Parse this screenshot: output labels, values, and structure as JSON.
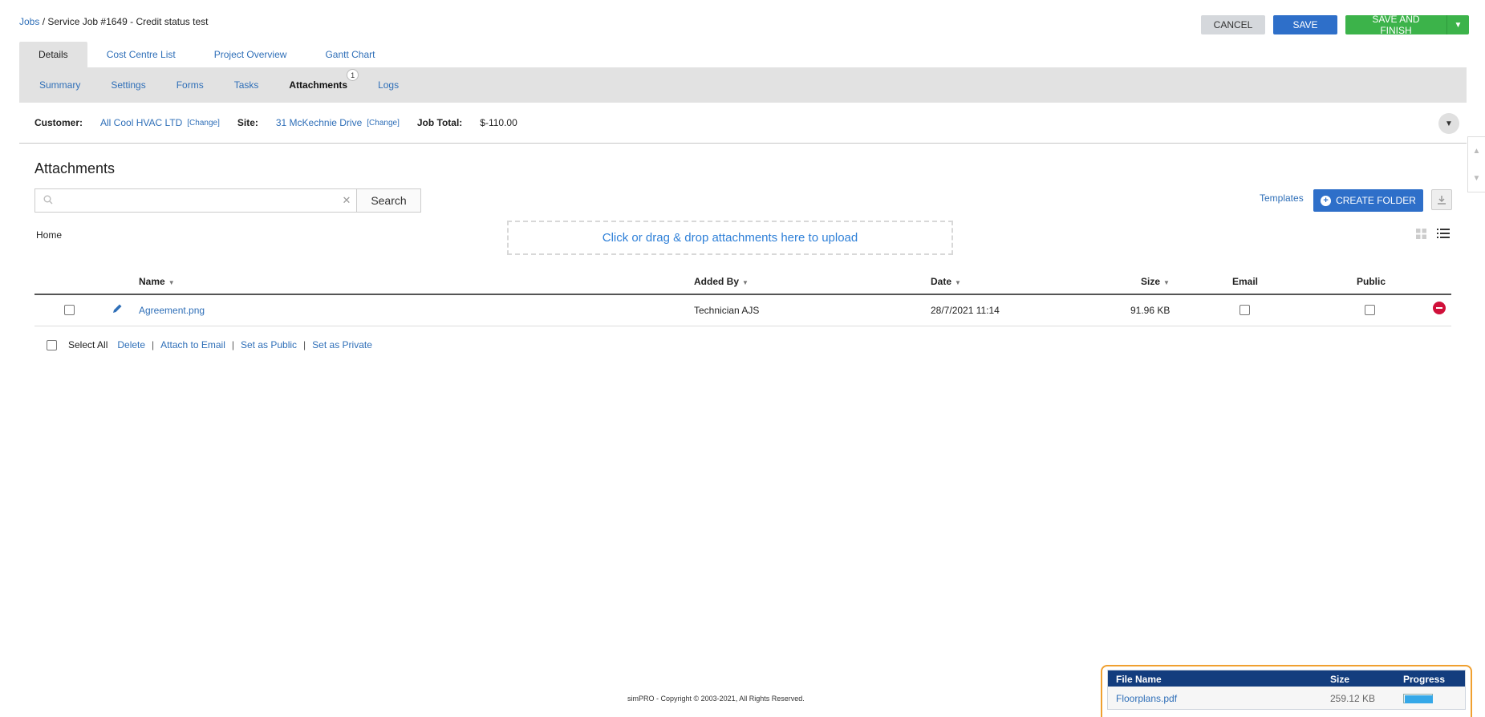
{
  "breadcrumb": {
    "root": "Jobs",
    "separator": " / ",
    "current": "Service Job #1649 - Credit status test"
  },
  "actions": {
    "cancel": "CANCEL",
    "save": "SAVE",
    "save_finish": "SAVE AND FINISH",
    "dropdown_icon": "caret-down-icon"
  },
  "main_tabs": [
    {
      "label": "Details",
      "active": true
    },
    {
      "label": "Cost Centre List"
    },
    {
      "label": "Project Overview"
    },
    {
      "label": "Gantt Chart"
    }
  ],
  "sub_tabs": [
    {
      "label": "Summary"
    },
    {
      "label": "Settings"
    },
    {
      "label": "Forms"
    },
    {
      "label": "Tasks"
    },
    {
      "label": "Attachments",
      "active": true,
      "badge": "1"
    },
    {
      "label": "Logs"
    }
  ],
  "info": {
    "customer_label": "Customer:",
    "customer": "All Cool HVAC LTD",
    "site_label": "Site:",
    "site": "31 McKechnie Drive",
    "change_label": "Change",
    "job_total_label": "Job Total:",
    "job_total": "$-110.00"
  },
  "attachments": {
    "title": "Attachments",
    "search_placeholder": "",
    "search_button": "Search",
    "templates_link": "Templates",
    "create_folder": "CREATE FOLDER",
    "home": "Home",
    "dropzone_text": "Click or drag & drop attachments here to upload",
    "columns": {
      "name": "Name",
      "added_by": "Added By",
      "date": "Date",
      "size": "Size",
      "email": "Email",
      "public": "Public"
    },
    "rows": [
      {
        "name": "Agreement.png",
        "added_by": "Technician AJS",
        "date": "28/7/2021 11:14",
        "size": "91.96 KB"
      }
    ],
    "bulk": {
      "select_all": "Select All",
      "delete": "Delete",
      "attach_email": "Attach to Email",
      "set_public": "Set as Public",
      "set_private": "Set as Private",
      "pipe": "|"
    }
  },
  "footer": "simPRO - Copyright © 2003-2021, All Rights Reserved.",
  "upload_panel": {
    "headers": {
      "file_name": "File Name",
      "size": "Size",
      "progress": "Progress"
    },
    "rows": [
      {
        "file_name": "Floorplans.pdf",
        "size": "259.12 KB",
        "progress_percent": 100
      }
    ]
  },
  "colors": {
    "accent": "#2e6fc9",
    "success": "#3cb34a",
    "upload_header": "#133d7e",
    "highlight_border": "#f0a030",
    "danger": "#d0103a"
  }
}
